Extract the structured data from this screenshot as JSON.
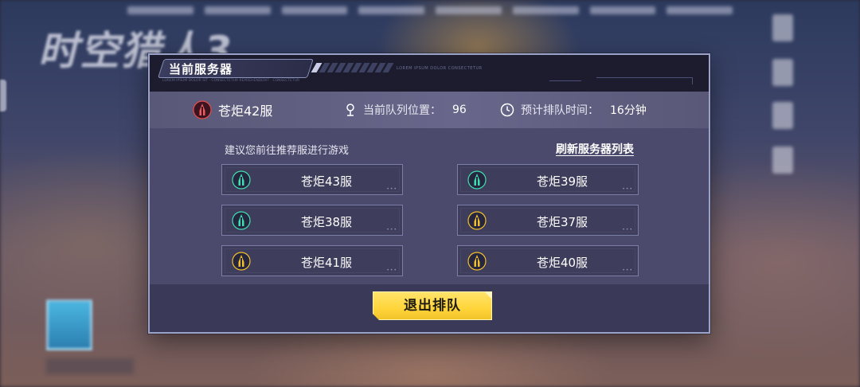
{
  "background": {
    "logo_text": "时空猎人3"
  },
  "dialog": {
    "title": "当前服务器",
    "header_tiny_text": "LOREM IPSUM DOLOR CONSECTETUR",
    "header_tiny_left": "LOREM IPSUM DOLOR SIT · CONSECTETUR REPREHENDERIT · CONSECTETUR"
  },
  "info": {
    "current_server": "苍炬42服",
    "queue_position_label": "当前队列位置：",
    "queue_position_value": "96",
    "estimated_time_label": "预计排队时间：",
    "estimated_time_value": "16分钟"
  },
  "content": {
    "suggest_text": "建议您前往推荐服进行游戏",
    "refresh_label": "刷新服务器列表"
  },
  "servers": [
    {
      "name": "苍炬43服",
      "status": "green"
    },
    {
      "name": "苍炬39服",
      "status": "green"
    },
    {
      "name": "苍炬38服",
      "status": "green"
    },
    {
      "name": "苍炬37服",
      "status": "yellow"
    },
    {
      "name": "苍炬41服",
      "status": "yellow"
    },
    {
      "name": "苍炬40服",
      "status": "yellow"
    }
  ],
  "footer": {
    "exit_label": "退出排队"
  },
  "colors": {
    "status_green": "#3fe0b0",
    "status_yellow": "#f2c02a",
    "status_red": "#e84a4a",
    "accent_yellow": "#ffd53a"
  }
}
